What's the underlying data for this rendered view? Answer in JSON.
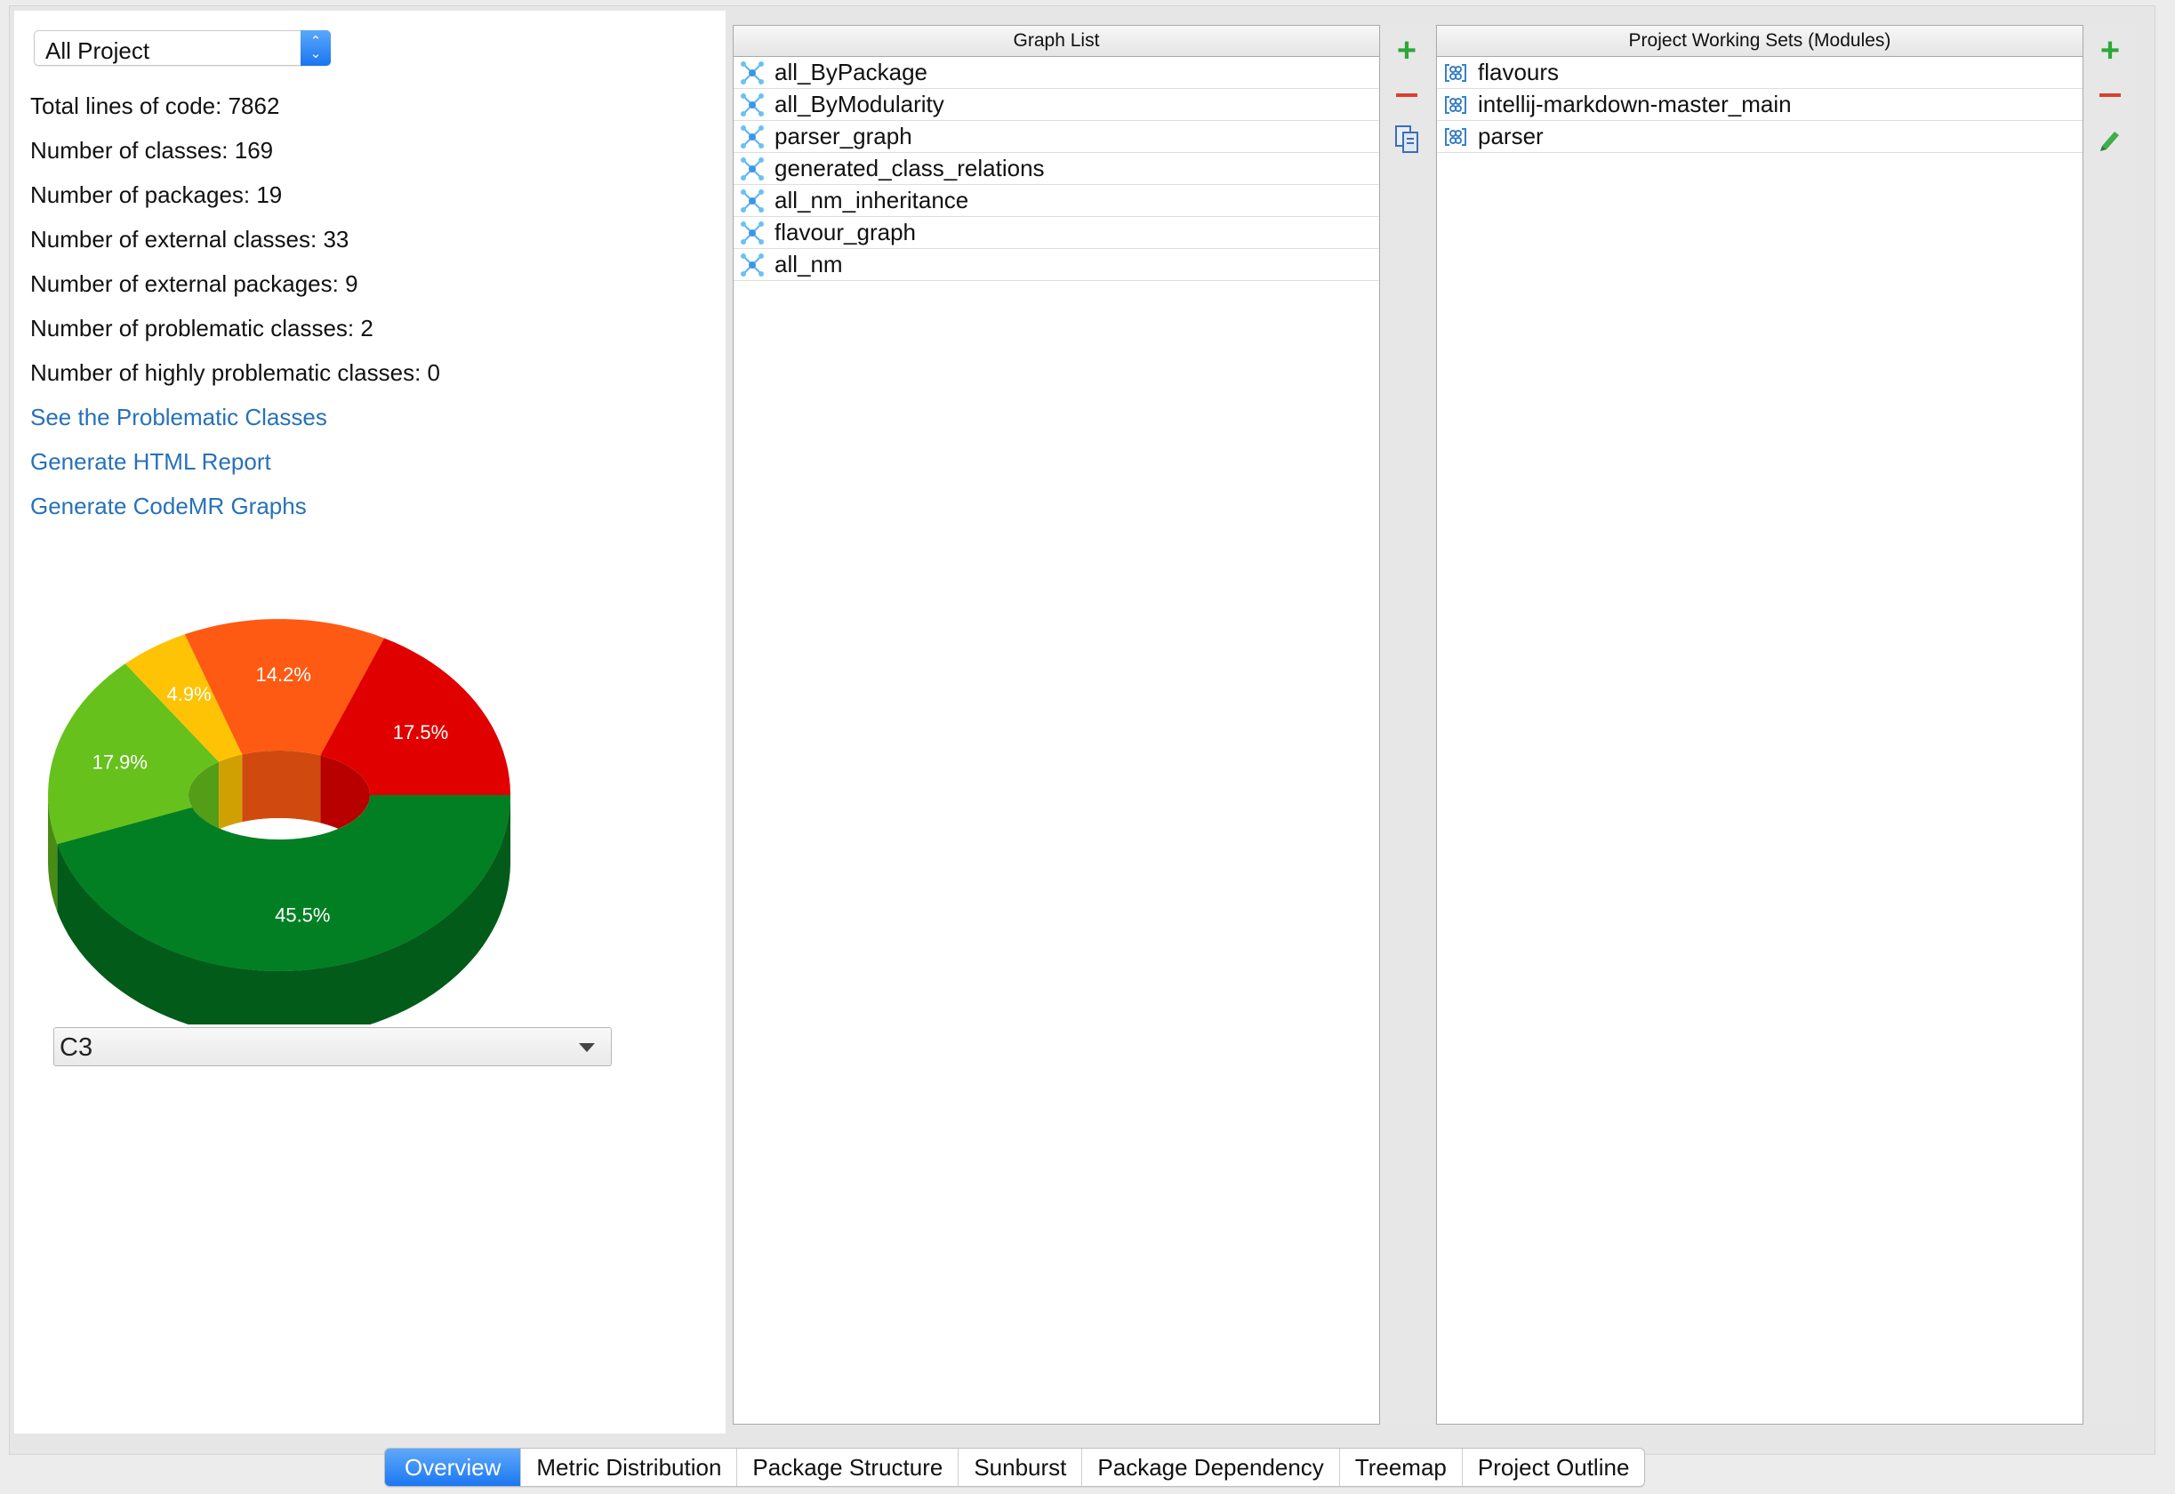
{
  "project_selector": {
    "value": "All Project"
  },
  "stats": [
    "Total lines of code: 7862",
    "Number of classes: 169",
    "Number of packages: 19",
    "Number of external classes: 33",
    "Number of external packages: 9",
    "Number of problematic classes: 2",
    "Number of highly problematic classes: 0"
  ],
  "links": [
    "See the Problematic Classes",
    "Generate HTML Report",
    "Generate CodeMR Graphs"
  ],
  "chart_data": {
    "type": "pie",
    "categories": [
      "",
      "",
      "",
      "",
      ""
    ],
    "values": [
      45.5,
      17.9,
      4.9,
      14.2,
      17.5
    ],
    "labels": [
      "45.5%",
      "17.9%",
      "4.9%",
      "14.2%",
      "17.5%"
    ],
    "colors": [
      "#037f23",
      "#66c11c",
      "#fec304",
      "#fe5a13",
      "#e00000"
    ],
    "style": "3d-donut"
  },
  "metric_selector": {
    "value": "C3"
  },
  "graph_list": {
    "title": "Graph List",
    "items": [
      "all_ByPackage",
      "all_ByModularity",
      "parser_graph",
      "generated_class_relations",
      "all_nm_inheritance",
      "flavour_graph",
      "all_nm"
    ]
  },
  "graph_toolbar": {
    "icons": [
      "plus-icon",
      "minus-icon",
      "copy-icon"
    ]
  },
  "working_sets": {
    "title": "Project Working Sets (Modules)",
    "items": [
      "flavours",
      "intellij-markdown-master_main",
      "parser"
    ]
  },
  "working_sets_toolbar": {
    "icons": [
      "plus-icon",
      "minus-icon",
      "pencil-icon"
    ]
  },
  "tabs": [
    "Overview",
    "Metric Distribution",
    "Package Structure",
    "Sunburst",
    "Package Dependency",
    "Treemap",
    "Project Outline"
  ],
  "active_tab": "Overview"
}
